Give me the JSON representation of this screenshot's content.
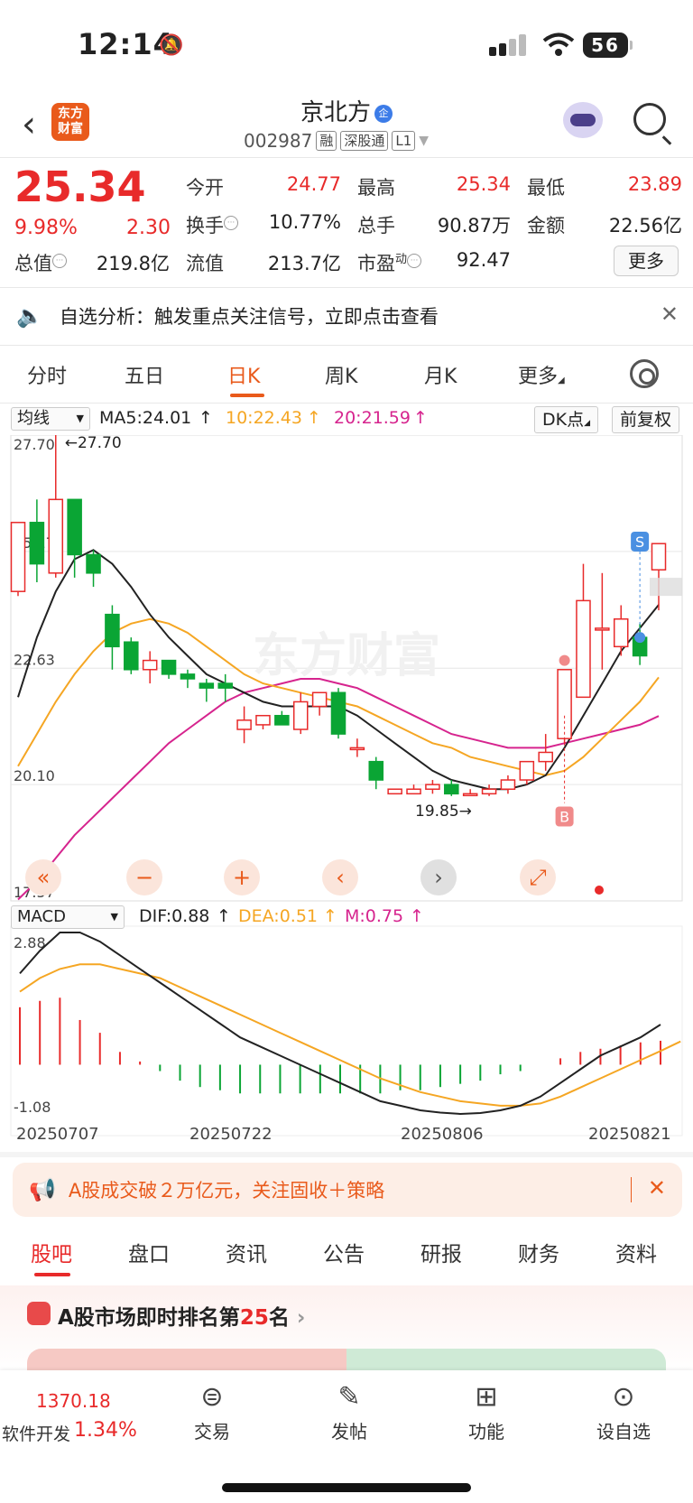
{
  "status_bar": {
    "time": "12:14",
    "battery": "56",
    "bell_icon": "bell-slash-icon",
    "wifi_icon": "wifi-icon"
  },
  "header": {
    "back_icon": "chevron-left-icon",
    "app_logo": "东方\n财富",
    "stock_name": "京北方",
    "badge": "企",
    "code": "002987",
    "tags": [
      "融",
      "深股通",
      "L1"
    ]
  },
  "quote": {
    "price": "25.34",
    "change_pct": "9.98%",
    "change": "2.30",
    "fields": [
      {
        "label": "今开",
        "value": "24.77",
        "color": "red"
      },
      {
        "label": "最高",
        "value": "25.34",
        "color": "red"
      },
      {
        "label": "最低",
        "value": "23.89",
        "color": "red"
      },
      {
        "label": "换手",
        "value": "10.77%",
        "color": "black"
      },
      {
        "label": "总手",
        "value": "90.87万",
        "color": "black"
      },
      {
        "label": "金额",
        "value": "22.56亿",
        "color": "black"
      },
      {
        "label": "总值",
        "value": "219.8亿",
        "color": "black"
      },
      {
        "label": "流值",
        "value": "213.7亿",
        "color": "black"
      },
      {
        "label": "市盈",
        "value": "92.47",
        "color": "black"
      }
    ],
    "pe_sup": "动",
    "more_label": "更多"
  },
  "notice": {
    "text": "自选分析：触发重点关注信号，立即点击查看"
  },
  "chart_tabs": [
    "分时",
    "五日",
    "日K",
    "周K",
    "月K",
    "更多"
  ],
  "active_tab": "日K",
  "ma_bar": {
    "selector": "均线",
    "ma5": "MA5:24.01",
    "ma10": "10:22.43",
    "ma20": "20:21.59",
    "dk": "DK点",
    "fq": "前复权"
  },
  "macd_bar": {
    "selector": "MACD",
    "dif": "DIF:0.88",
    "dea": "DEA:0.51",
    "m": "M:0.75"
  },
  "chart_data": {
    "type": "candlestick",
    "y_ticks": [
      "27.70",
      "25.17",
      "22.63",
      "20.10",
      "17.57"
    ],
    "ylim": [
      17.57,
      27.7
    ],
    "high_label": "27.70",
    "low_label": "19.85",
    "dates": [
      "20250707",
      "20250722",
      "20250806",
      "20250821"
    ],
    "candles": [
      {
        "o": 24.3,
        "c": 25.8,
        "h": 25.8,
        "l": 24.2
      },
      {
        "o": 25.8,
        "c": 24.9,
        "h": 26.3,
        "l": 24.5
      },
      {
        "o": 24.7,
        "c": 26.3,
        "h": 27.7,
        "l": 24.6
      },
      {
        "o": 26.3,
        "c": 25.1,
        "h": 26.3,
        "l": 24.6
      },
      {
        "o": 25.1,
        "c": 24.7,
        "h": 25.2,
        "l": 24.4
      },
      {
        "o": 23.8,
        "c": 23.1,
        "h": 24.0,
        "l": 22.6
      },
      {
        "o": 23.2,
        "c": 22.6,
        "h": 23.3,
        "l": 22.5
      },
      {
        "o": 22.6,
        "c": 22.8,
        "h": 23.0,
        "l": 22.3
      },
      {
        "o": 22.8,
        "c": 22.5,
        "h": 22.8,
        "l": 22.4
      },
      {
        "o": 22.5,
        "c": 22.4,
        "h": 22.6,
        "l": 22.2
      },
      {
        "o": 22.3,
        "c": 22.2,
        "h": 22.4,
        "l": 21.9
      },
      {
        "o": 22.3,
        "c": 22.2,
        "h": 22.5,
        "l": 21.9
      },
      {
        "o": 21.3,
        "c": 21.5,
        "h": 21.8,
        "l": 21.0
      },
      {
        "o": 21.4,
        "c": 21.6,
        "h": 21.6,
        "l": 21.3
      },
      {
        "o": 21.6,
        "c": 21.4,
        "h": 21.7,
        "l": 21.4
      },
      {
        "o": 21.3,
        "c": 21.9,
        "h": 22.1,
        "l": 21.2
      },
      {
        "o": 21.8,
        "c": 22.1,
        "h": 22.1,
        "l": 21.6
      },
      {
        "o": 22.1,
        "c": 21.2,
        "h": 22.2,
        "l": 21.1
      },
      {
        "o": 20.9,
        "c": 20.9,
        "h": 21.1,
        "l": 20.7
      },
      {
        "o": 20.6,
        "c": 20.2,
        "h": 20.7,
        "l": 20.0
      },
      {
        "o": 19.9,
        "c": 20.0,
        "h": 20.0,
        "l": 19.9
      },
      {
        "o": 19.9,
        "c": 20.0,
        "h": 20.1,
        "l": 19.9
      },
      {
        "o": 20.0,
        "c": 20.1,
        "h": 20.2,
        "l": 19.9
      },
      {
        "o": 20.1,
        "c": 19.9,
        "h": 20.2,
        "l": 19.85
      },
      {
        "o": 19.9,
        "c": 19.9,
        "h": 20.0,
        "l": 19.85
      },
      {
        "o": 19.9,
        "c": 20.0,
        "h": 20.1,
        "l": 19.85
      },
      {
        "o": 20.0,
        "c": 20.2,
        "h": 20.3,
        "l": 19.9
      },
      {
        "o": 20.2,
        "c": 20.6,
        "h": 20.6,
        "l": 20.1
      },
      {
        "o": 20.6,
        "c": 20.8,
        "h": 21.2,
        "l": 20.4
      },
      {
        "o": 21.1,
        "c": 22.6,
        "h": 22.6,
        "l": 21.0
      },
      {
        "o": 22.0,
        "c": 24.1,
        "h": 24.9,
        "l": 22.0
      },
      {
        "o": 23.5,
        "c": 23.5,
        "h": 24.7,
        "l": 22.6
      },
      {
        "o": 23.1,
        "c": 23.7,
        "h": 24.0,
        "l": 22.9
      },
      {
        "o": 23.3,
        "c": 22.9,
        "h": 23.6,
        "l": 22.7
      },
      {
        "o": 24.77,
        "c": 25.34,
        "h": 25.34,
        "l": 23.89
      }
    ],
    "ma5": [
      22.0,
      23.3,
      24.3,
      25.0,
      25.2,
      24.9,
      24.4,
      23.8,
      23.3,
      22.9,
      22.5,
      22.3,
      22.1,
      21.9,
      21.8,
      21.8,
      21.8,
      21.8,
      21.6,
      21.3,
      21.0,
      20.7,
      20.4,
      20.2,
      20.1,
      20.0,
      20.0,
      20.1,
      20.3,
      20.9,
      21.6,
      22.3,
      23.0,
      23.5,
      24.01
    ],
    "ma10": [
      20.5,
      21.2,
      21.9,
      22.5,
      23.0,
      23.4,
      23.6,
      23.7,
      23.6,
      23.4,
      23.1,
      22.8,
      22.5,
      22.3,
      22.2,
      22.1,
      22.0,
      21.9,
      21.8,
      21.6,
      21.4,
      21.2,
      21.0,
      20.9,
      20.7,
      20.6,
      20.5,
      20.4,
      20.3,
      20.4,
      20.7,
      21.1,
      21.5,
      21.9,
      22.43
    ],
    "ma20": [
      17.6,
      18.0,
      18.5,
      19.0,
      19.4,
      19.8,
      20.2,
      20.6,
      21.0,
      21.3,
      21.6,
      21.9,
      22.1,
      22.2,
      22.3,
      22.4,
      22.4,
      22.3,
      22.2,
      22.0,
      21.8,
      21.6,
      21.4,
      21.2,
      21.1,
      21.0,
      20.9,
      20.9,
      20.9,
      21.0,
      21.1,
      21.2,
      21.3,
      21.4,
      21.59
    ],
    "markers": {
      "buy": "B",
      "sell": "S"
    },
    "macd": {
      "y_ticks": [
        "2.88",
        "-1.08"
      ],
      "ylim": [
        -1.08,
        2.88
      ],
      "dif": [
        2.0,
        2.5,
        2.9,
        2.9,
        2.7,
        2.4,
        2.1,
        1.8,
        1.5,
        1.2,
        0.9,
        0.6,
        0.4,
        0.2,
        0.0,
        -0.2,
        -0.4,
        -0.6,
        -0.8,
        -0.9,
        -1.0,
        -1.05,
        -1.08,
        -1.06,
        -1.0,
        -0.9,
        -0.7,
        -0.4,
        -0.1,
        0.2,
        0.4,
        0.6,
        0.88
      ],
      "dea": [
        1.6,
        1.9,
        2.1,
        2.2,
        2.2,
        2.1,
        2.0,
        1.9,
        1.7,
        1.5,
        1.3,
        1.1,
        0.9,
        0.7,
        0.5,
        0.3,
        0.1,
        -0.1,
        -0.3,
        -0.45,
        -0.6,
        -0.7,
        -0.8,
        -0.85,
        -0.9,
        -0.9,
        -0.85,
        -0.7,
        -0.5,
        -0.3,
        -0.1,
        0.1,
        0.3,
        0.51
      ],
      "m": [
        1.8,
        2.0,
        2.1,
        1.4,
        1.0,
        0.4,
        0.1,
        -0.2,
        -0.5,
        -0.7,
        -0.8,
        -0.9,
        -0.9,
        -0.9,
        -0.9,
        -0.9,
        -0.9,
        -0.9,
        -0.9,
        -0.8,
        -0.8,
        -0.7,
        -0.6,
        -0.5,
        -0.3,
        -0.2,
        0.0,
        0.2,
        0.4,
        0.5,
        0.6,
        0.7,
        0.75
      ]
    }
  },
  "colors": {
    "up": "#e82a2a",
    "down": "#0aa534",
    "ma5": "#222222",
    "ma10": "#f5a623",
    "ma20": "#d6248e",
    "accent": "#e95a1b"
  },
  "banner": {
    "text": "A股成交破２万亿元，关注固收＋策略"
  },
  "sub_tabs": [
    "股吧",
    "盘口",
    "资讯",
    "公告",
    "研报",
    "财务",
    "资料"
  ],
  "rank": {
    "prefix": "A股市场即时排名第",
    "num": "25",
    "suffix": "名"
  },
  "bottom_nav": {
    "index_value": "1370.18",
    "index_name": "软件开发",
    "index_pct": "1.34%",
    "items": [
      {
        "label": "交易",
        "icon": "yen-icon"
      },
      {
        "label": "发帖",
        "icon": "edit-icon"
      },
      {
        "label": "功能",
        "icon": "grid-icon"
      },
      {
        "label": "设自选",
        "icon": "more-icon"
      }
    ]
  }
}
